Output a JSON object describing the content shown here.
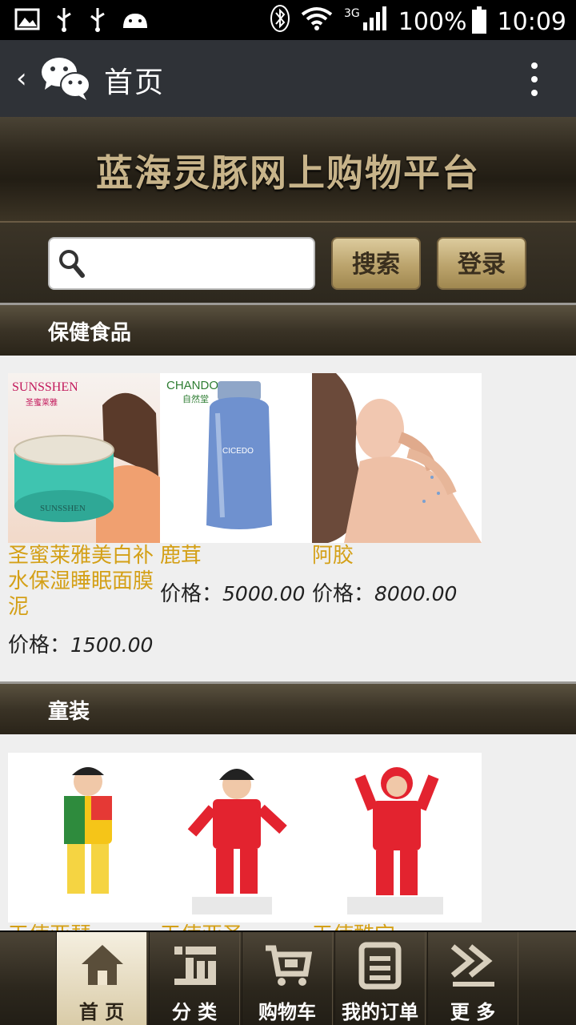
{
  "status_bar": {
    "battery": "100%",
    "time": "10:09",
    "network": "3G"
  },
  "action_bar": {
    "back": "‹",
    "title": "首页"
  },
  "banner": {
    "title": "蓝海灵豚网上购物平台"
  },
  "search": {
    "placeholder": "",
    "search_button": "搜索",
    "login_button": "登录"
  },
  "sections": [
    {
      "title": "保健食品",
      "products": [
        {
          "name": "圣蜜莱雅美白补水保湿睡眠面膜泥",
          "price_label": "价格：",
          "price": "1500.00",
          "brand": "SUNSSHEN",
          "brand_cn": "圣蜜莱雅"
        },
        {
          "name": "鹿茸",
          "price_label": "价格：",
          "price": "5000.00",
          "brand": "CHANDO",
          "brand_cn": "自然堂"
        },
        {
          "name": "阿胶",
          "price_label": "价格：",
          "price": "8000.00"
        }
      ]
    },
    {
      "title": "童装",
      "products": [
        {
          "name": "天使亚瑟"
        },
        {
          "name": "天使亚圣"
        },
        {
          "name": "天使酷宝"
        }
      ]
    }
  ],
  "tabs": [
    {
      "label": "首 页",
      "icon": "home-icon",
      "active": true
    },
    {
      "label": "分 类",
      "icon": "category-icon",
      "active": false
    },
    {
      "label": "购物车",
      "icon": "cart-icon",
      "active": false
    },
    {
      "label": "我的订单",
      "icon": "orders-icon",
      "active": false
    },
    {
      "label": "更 多",
      "icon": "more-icon",
      "active": false
    }
  ],
  "colors": {
    "accent_gold": "#d4a017",
    "header_dark": "#2f3237",
    "button_gold": "#bba36c"
  }
}
